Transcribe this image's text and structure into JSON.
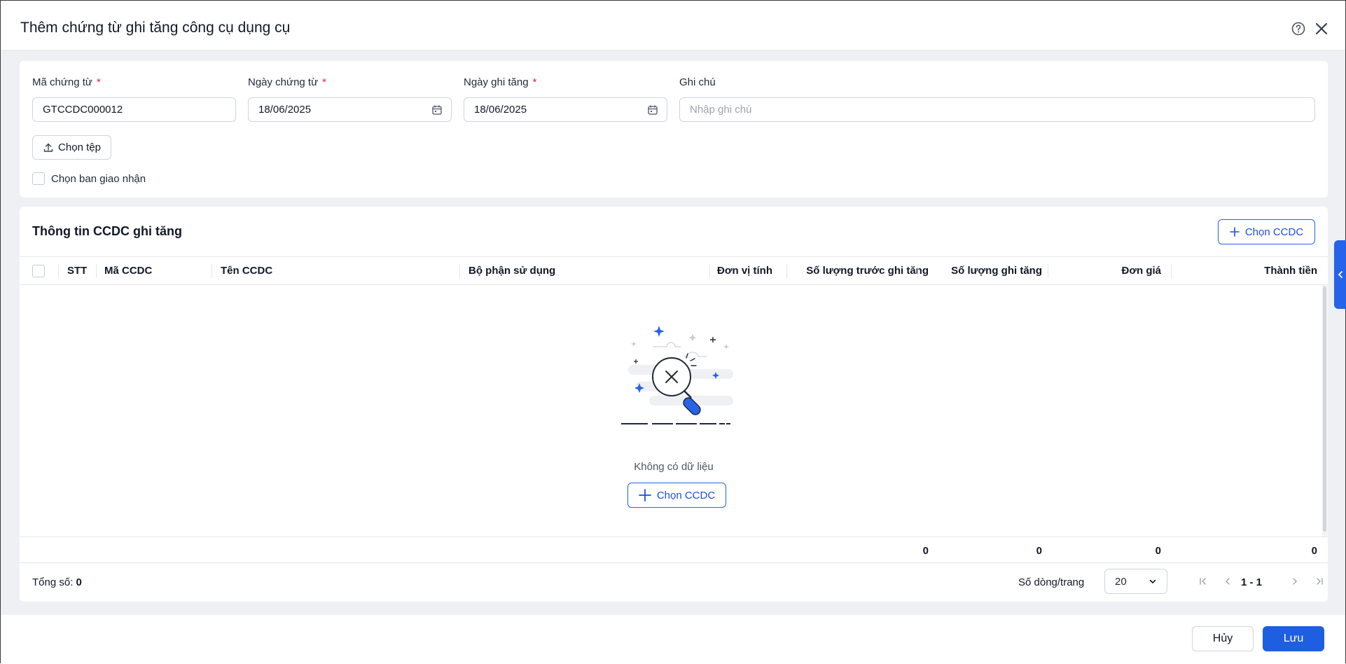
{
  "dialog": {
    "title": "Thêm chứng từ ghi tăng công cụ dụng cụ"
  },
  "form": {
    "doc_code": {
      "label": "Mã chứng từ",
      "required_mark": "*",
      "value": "GTCCDC000012"
    },
    "doc_date": {
      "label": "Ngày chứng từ",
      "required_mark": "*",
      "value": "18/06/2025"
    },
    "record_date": {
      "label": "Ngày ghi tăng",
      "required_mark": "*",
      "value": "18/06/2025"
    },
    "note": {
      "label": "Ghi chú",
      "placeholder": "Nhập ghi chú",
      "value": ""
    },
    "upload_label": "Chọn tệp",
    "handover_checkbox_label": "Chọn ban giao nhận"
  },
  "table_section": {
    "title": "Thông tin CCDC ghi tăng",
    "add_button_label": "Chọn CCDC",
    "columns": [
      "STT",
      "Mã CCDC",
      "Tên CCDC",
      "Bộ phận sử dụng",
      "Đơn vị tính",
      "Số lượng trước ghi tăng",
      "Số lượng ghi tăng",
      "Đơn giá",
      "Thành tiền"
    ],
    "empty_text": "Không có dữ liệu",
    "empty_add_label": "Chọn CCDC",
    "totals": [
      "0",
      "0",
      "0",
      "0"
    ]
  },
  "pagination": {
    "total_label": "Tổng số:",
    "total_value": "0",
    "rows_per_page_label": "Số dòng/trang",
    "rows_per_page": "20",
    "range": "1 - 1"
  },
  "footer": {
    "cancel_label": "Hủy",
    "save_label": "Lưu"
  },
  "colors": {
    "primary": "#1d5fe0",
    "required": "#e11d48"
  }
}
